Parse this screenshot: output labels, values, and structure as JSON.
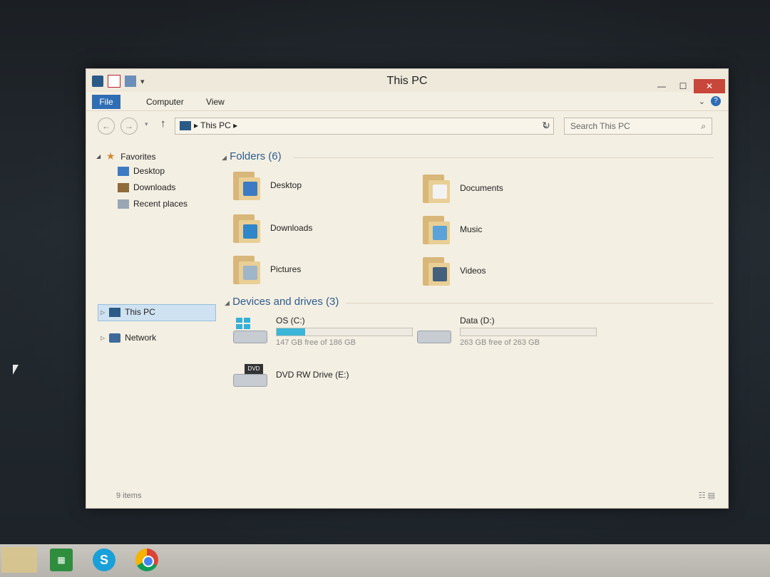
{
  "window": {
    "title": "This PC",
    "controls": {
      "minimize": "—",
      "maximize": "☐",
      "close": "✕"
    }
  },
  "ribbon": {
    "tabs": [
      "File",
      "Computer",
      "View"
    ]
  },
  "navigation": {
    "back": "←",
    "forward": "→",
    "up": "↑",
    "breadcrumb": "This PC",
    "search_placeholder": "Search This PC"
  },
  "nav_pane": {
    "favorites_label": "Favorites",
    "favorites": [
      "Desktop",
      "Downloads",
      "Recent places"
    ],
    "this_pc": "This PC",
    "network": "Network"
  },
  "content": {
    "folders_header": "Folders (6)",
    "folders": [
      {
        "name": "Desktop",
        "badge_color": "#3c7bc4"
      },
      {
        "name": "Documents",
        "badge_color": "#f3f3f3"
      },
      {
        "name": "Downloads",
        "badge_color": "#2f86c9"
      },
      {
        "name": "Music",
        "badge_color": "#5aa2d8"
      },
      {
        "name": "Pictures",
        "badge_color": "#9fb5c8"
      },
      {
        "name": "Videos",
        "badge_color": "#44607c"
      }
    ],
    "drives_header": "Devices and drives (3)",
    "drives": [
      {
        "name": "OS (C:)",
        "free": "147 GB free of 186 GB",
        "used_fraction": 0.21
      },
      {
        "name": "Data (D:)",
        "free": "263 GB free of 263 GB",
        "used_fraction": 0.0
      },
      {
        "name": "DVD RW Drive (E:)",
        "dvd_label": "DVD"
      }
    ]
  },
  "status_bar": {
    "items": "9 items"
  },
  "taskbar": {
    "store_label": "▦",
    "skype_label": "S"
  }
}
